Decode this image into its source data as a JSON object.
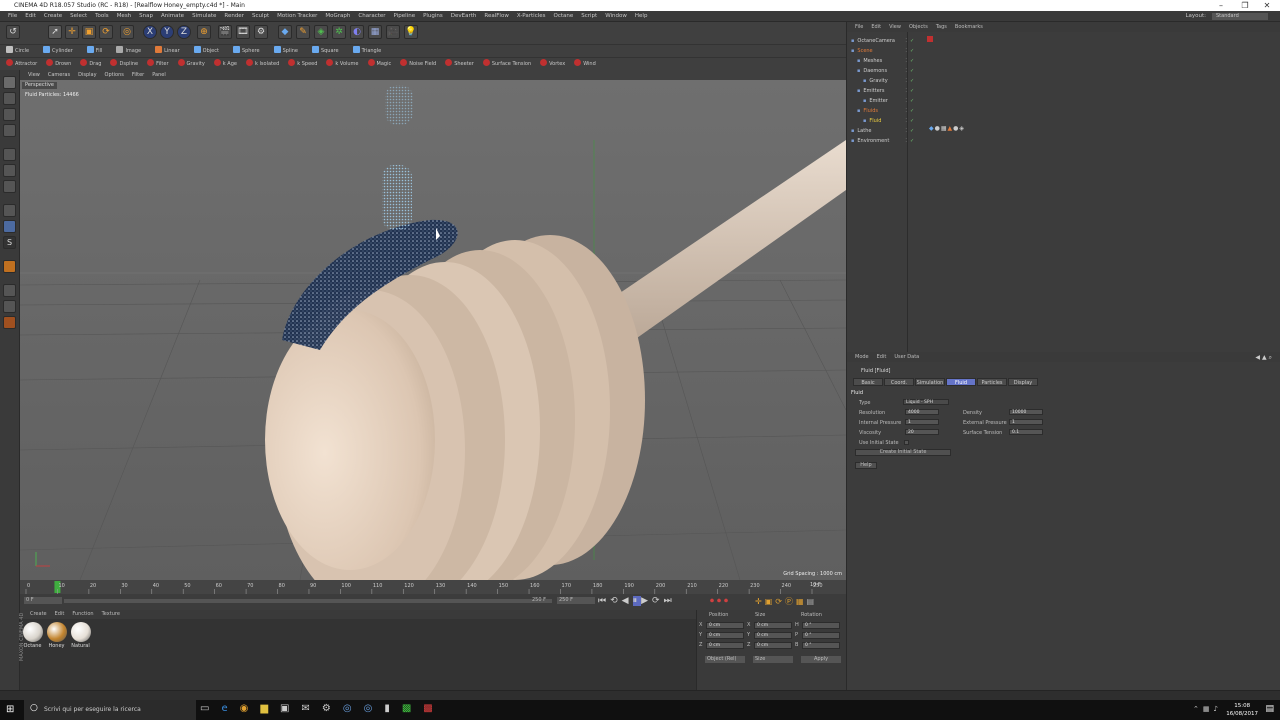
{
  "window": {
    "title": "CINEMA 4D R18.057 Studio (RC - R18) - [Realflow Honey_empty.c4d *] - Main",
    "minimize": "–",
    "maximize": "❐",
    "close": "✕"
  },
  "menu": [
    "File",
    "Edit",
    "Create",
    "Select",
    "Tools",
    "Mesh",
    "Snap",
    "Animate",
    "Simulate",
    "Render",
    "Sculpt",
    "Motion Tracker",
    "MoGraph",
    "Character",
    "Pipeline",
    "Plugins",
    "DevEarth",
    "RealFlow",
    "X-Particles",
    "Octane",
    "Script",
    "Window",
    "Help"
  ],
  "layout": {
    "label": "Layout:",
    "value": "Standard"
  },
  "toolbar": {
    "undo": "↺",
    "axes": [
      "X",
      "Y",
      "Z"
    ]
  },
  "object_tools": [
    "Circle",
    "Cylinder",
    "Fill",
    "Image",
    "Linear",
    "Object",
    "Sphere",
    "Spline",
    "Square",
    "Triangle"
  ],
  "dynamics_tools": [
    "Attractor",
    "Drown",
    "Drag",
    "Dspline",
    "Filter",
    "Gravity",
    "k Age",
    "k Isolated",
    "k Speed",
    "k Volume",
    "Magic",
    "Noise Field",
    "Sheeter",
    "Surface Tension",
    "Vortex",
    "Wind"
  ],
  "viewport": {
    "menu": [
      "View",
      "Cameras",
      "Display",
      "Options",
      "Filter",
      "Panel"
    ],
    "camera": "Perspective",
    "particles": "Fluid Particles: 14466",
    "grid_spacing": "Grid Spacing : 1000 cm"
  },
  "timeline": {
    "ticks": [
      "0",
      "10",
      "20",
      "30",
      "40",
      "50",
      "60",
      "70",
      "80",
      "90",
      "100",
      "110",
      "120",
      "130",
      "140",
      "150",
      "160",
      "170",
      "180",
      "190",
      "200",
      "210",
      "220",
      "230",
      "240",
      "250"
    ],
    "current_frame_marker": "10 F",
    "start_field": "0 F",
    "end_field": "250 F",
    "min_field": "250 F",
    "playhead_value": 10
  },
  "materials": {
    "menu": [
      "Create",
      "Edit",
      "Function",
      "Texture"
    ],
    "items": [
      {
        "name": "Octane",
        "color": "#d9d4cc"
      },
      {
        "name": "Honey",
        "color": "#c2842e"
      },
      {
        "name": "Natural",
        "color": "#e6dfd6"
      }
    ],
    "brand": "MAXON CINEMA 4D"
  },
  "coordinates": {
    "headers": [
      "Position",
      "Size",
      "Rotation"
    ],
    "rows": [
      {
        "axis": "X",
        "pos": "0 cm",
        "size_axis": "X",
        "size": "0 cm",
        "rot_axis": "H",
        "rot": "0 °"
      },
      {
        "axis": "Y",
        "pos": "0 cm",
        "size_axis": "Y",
        "size": "0 cm",
        "rot_axis": "P",
        "rot": "0 °"
      },
      {
        "axis": "Z",
        "pos": "0 cm",
        "size_axis": "Z",
        "size": "0 cm",
        "rot_axis": "B",
        "rot": "0 °"
      }
    ],
    "mode_select": "Object (Rel)",
    "size_select": "Size",
    "apply": "Apply"
  },
  "objects": {
    "menu": [
      "File",
      "Edit",
      "View",
      "Objects",
      "Tags",
      "Bookmarks"
    ],
    "tree": [
      {
        "name": "OctaneCamera",
        "depth": 0,
        "color": "#d0d0d0"
      },
      {
        "name": "Scene",
        "depth": 0,
        "color": "#e07a3a"
      },
      {
        "name": "Meshes",
        "depth": 1,
        "color": "#d0d0d0"
      },
      {
        "name": "Daemons",
        "depth": 1,
        "color": "#d0d0d0"
      },
      {
        "name": "Gravity",
        "depth": 2,
        "color": "#d0d0d0"
      },
      {
        "name": "Emitters",
        "depth": 1,
        "color": "#d0d0d0"
      },
      {
        "name": "Emitter",
        "depth": 2,
        "color": "#d0d0d0"
      },
      {
        "name": "Fluids",
        "depth": 1,
        "color": "#e07a3a"
      },
      {
        "name": "Fluid",
        "depth": 2,
        "color": "#f0d040"
      },
      {
        "name": "Lathe",
        "depth": 0,
        "color": "#d0d0d0"
      },
      {
        "name": "Environment",
        "depth": 0,
        "color": "#d0d0d0"
      }
    ]
  },
  "attributes": {
    "menu": [
      "Mode",
      "Edit",
      "User Data"
    ],
    "title": "Fluid [Fluid]",
    "tabs": [
      "Basic",
      "Coord.",
      "Simulation",
      "Fluid",
      "Particles",
      "Display"
    ],
    "active_tab": "Fluid",
    "section": "Fluid",
    "type_label": "Type",
    "type_value": "Liquid - SPH",
    "left_fields": [
      {
        "label": "Resolution",
        "value": "4000"
      },
      {
        "label": "Internal Pressure",
        "value": "1"
      },
      {
        "label": "Viscosity",
        "value": "20"
      }
    ],
    "right_fields": [
      {
        "label": "Density",
        "value": "10000"
      },
      {
        "label": "External Pressure",
        "value": "1"
      },
      {
        "label": "Surface Tension",
        "value": "0.1"
      }
    ],
    "use_initial_state": "Use Initial State",
    "create_initial_state": "Create Initial State",
    "help": "Help"
  },
  "taskbar": {
    "search_placeholder": "Scrivi qui per eseguire la ricerca",
    "time": "15:08",
    "date": "16/08/2017"
  }
}
